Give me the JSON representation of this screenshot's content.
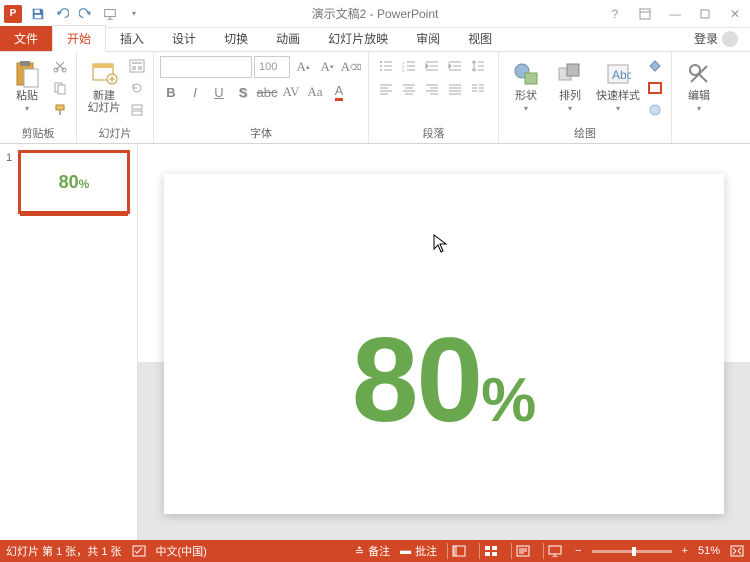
{
  "title": "演示文稿2 - PowerPoint",
  "qat": {
    "save": "save-icon",
    "undo": "undo-icon",
    "redo": "redo-icon",
    "start": "start-icon"
  },
  "tabs": {
    "file": "文件",
    "items": [
      "开始",
      "插入",
      "设计",
      "切换",
      "动画",
      "幻灯片放映",
      "审阅",
      "视图"
    ],
    "active_index": 0,
    "login": "登录"
  },
  "ribbon": {
    "clipboard": {
      "paste": "粘贴",
      "label": "剪贴板"
    },
    "slides": {
      "new_slide": "新建\n幻灯片",
      "label": "幻灯片"
    },
    "font": {
      "size": "100",
      "label": "字体"
    },
    "paragraph": {
      "label": "段落"
    },
    "drawing": {
      "shapes": "形状",
      "arrange": "排列",
      "quick_styles": "快速样式",
      "label": "绘图"
    },
    "editing": {
      "edit": "编辑",
      "label": ""
    }
  },
  "thumbnail": {
    "number": "1",
    "text": "80",
    "pct": "%"
  },
  "slide": {
    "text": "80",
    "pct": "%"
  },
  "status": {
    "slide_info": "幻灯片 第 1 张，共 1 张",
    "lang": "中文(中国)",
    "notes": "备注",
    "comments": "批注",
    "zoom": "51%"
  }
}
